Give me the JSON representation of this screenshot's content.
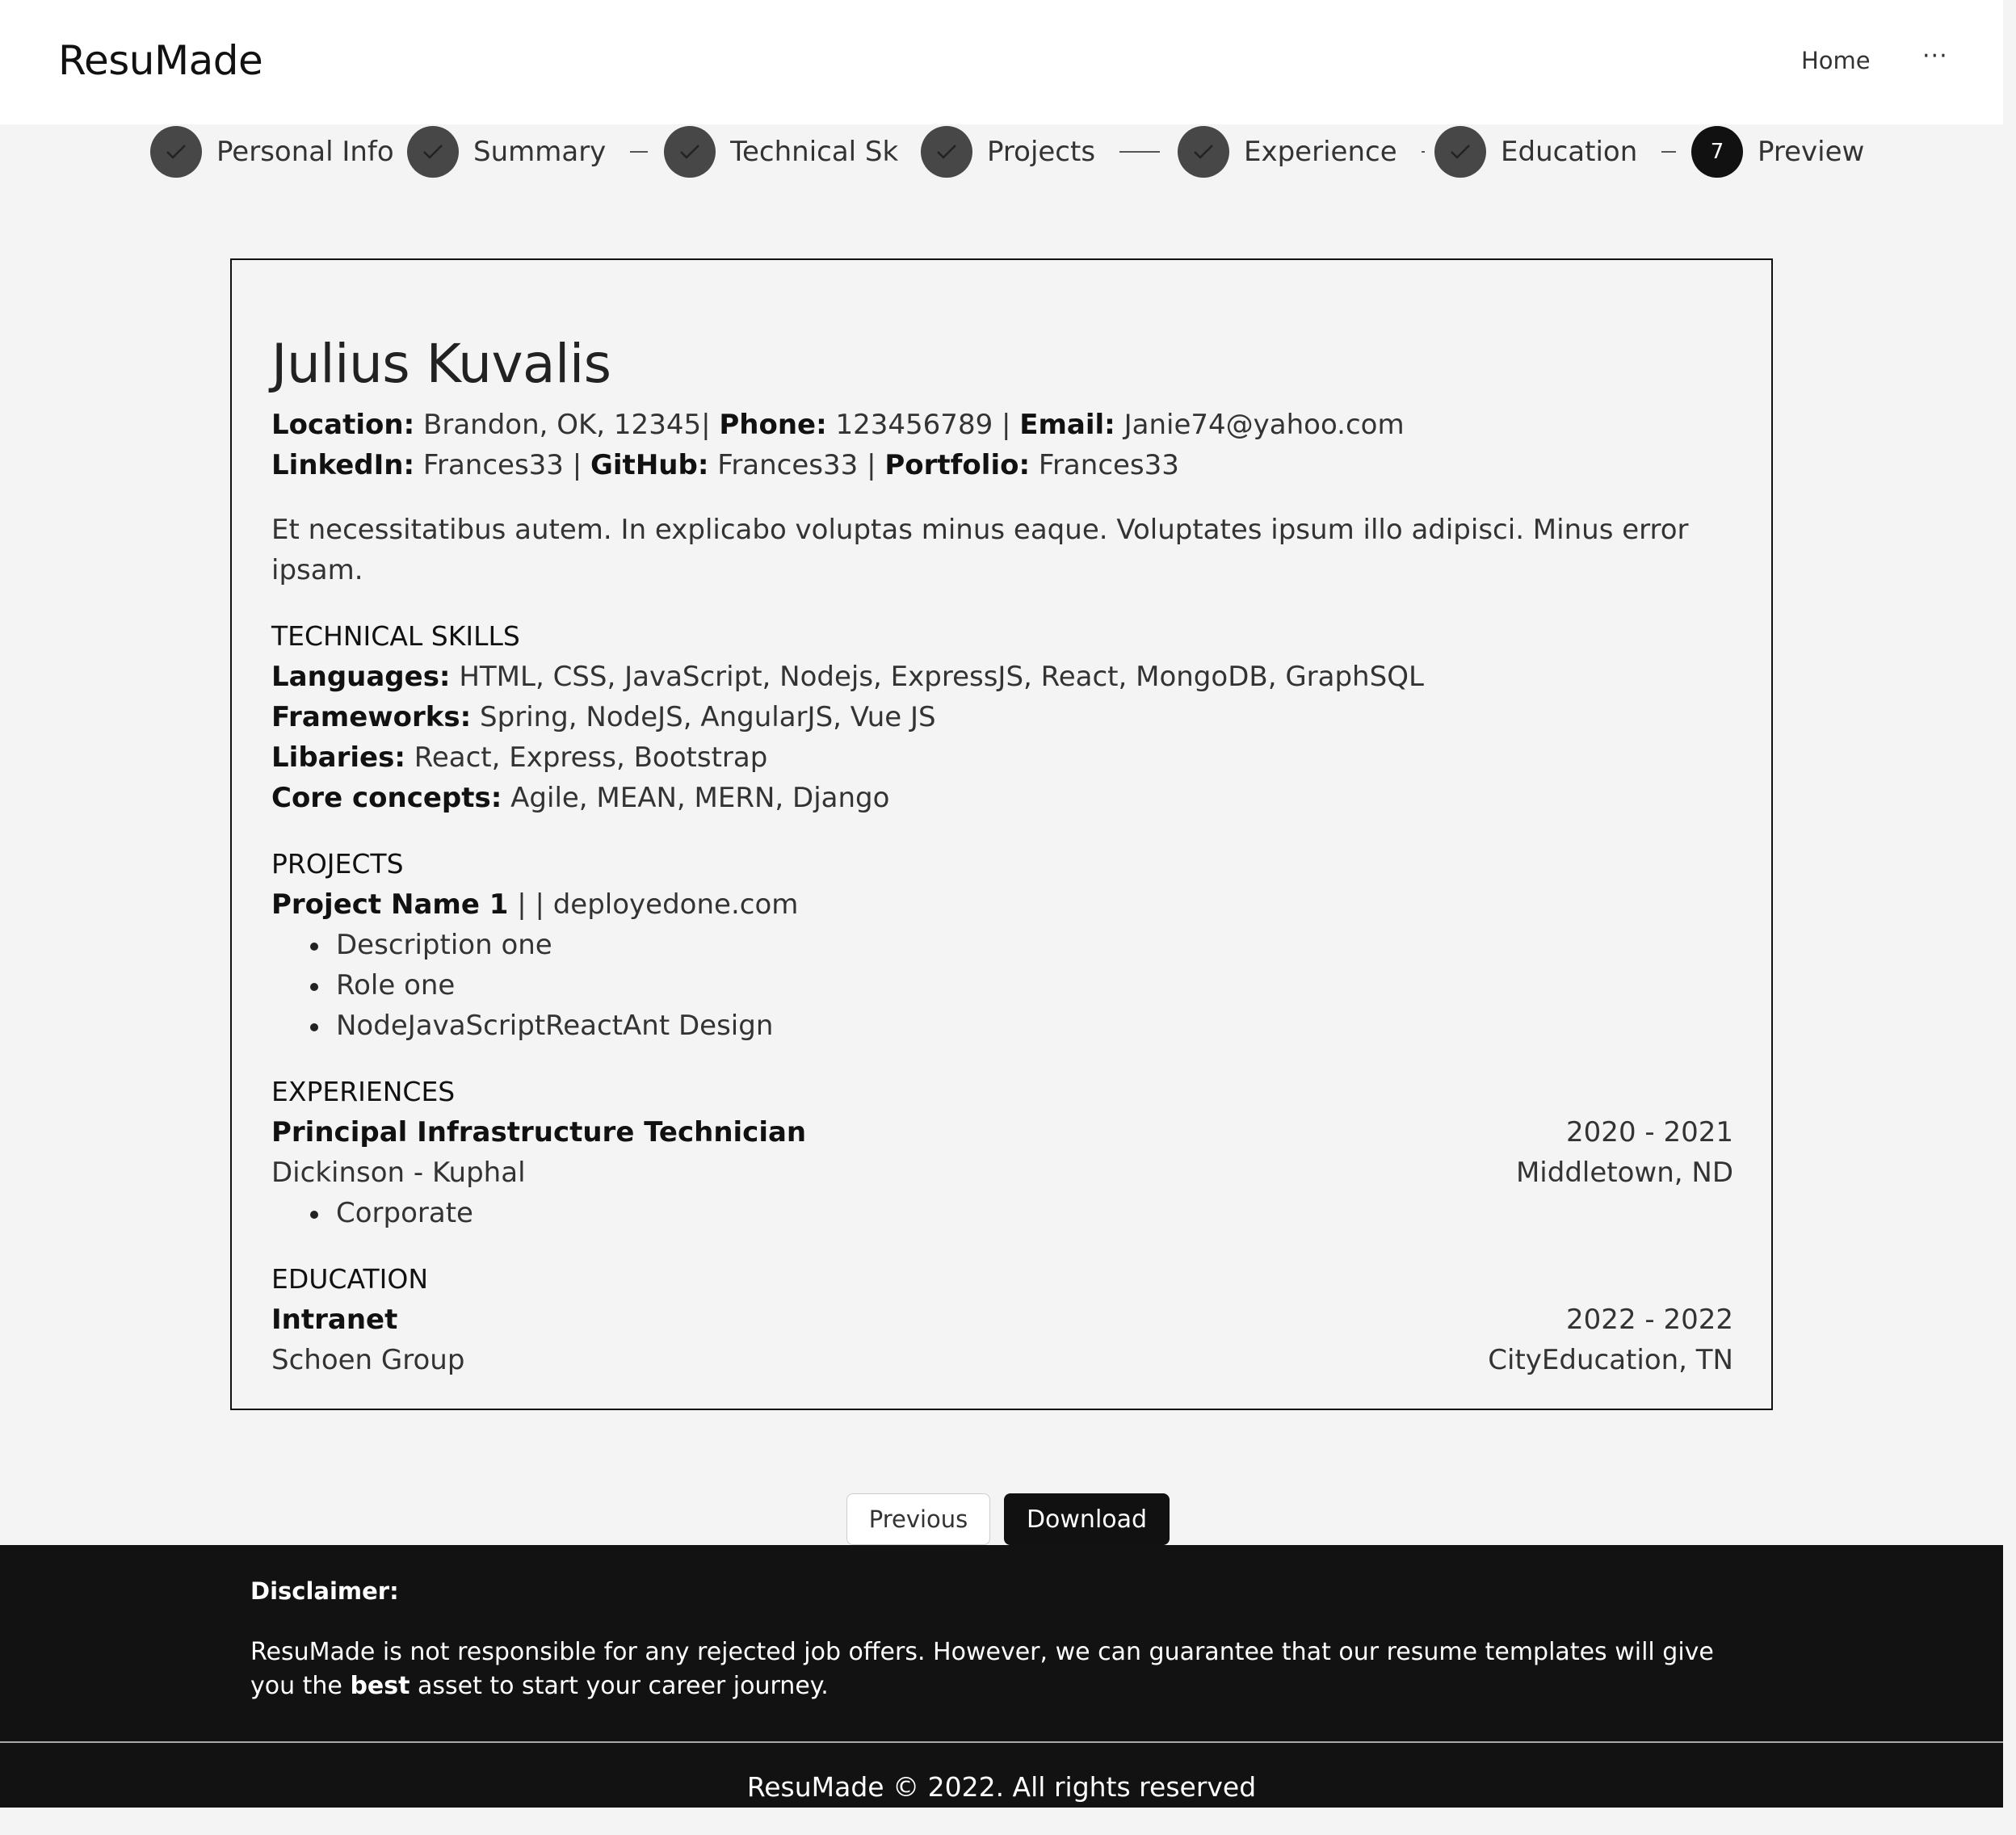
{
  "header": {
    "brand": "ResuMade",
    "home": "Home",
    "more": "···"
  },
  "steps": [
    {
      "label": "Personal Info",
      "state": "done"
    },
    {
      "label": "Summary",
      "state": "done"
    },
    {
      "label": "Technical Skills",
      "state": "done"
    },
    {
      "label": "Projects",
      "state": "done"
    },
    {
      "label": "Experience",
      "state": "done"
    },
    {
      "label": "Education",
      "state": "done"
    },
    {
      "label": "Preview",
      "state": "active",
      "number": "7"
    }
  ],
  "resume": {
    "name": "Julius Kuvalis",
    "contact": {
      "location_label": "Location:",
      "location": "Brandon, OK, 12345|",
      "phone_label": "Phone:",
      "phone": "123456789 |",
      "email_label": "Email:",
      "email": "Janie74@yahoo.com",
      "linkedin_label": "LinkedIn:",
      "linkedin": "Frances33 |",
      "github_label": "GitHub:",
      "github": "Frances33 |",
      "portfolio_label": "Portfolio:",
      "portfolio": "Frances33"
    },
    "summary": "Et necessitatibus autem. In explicabo voluptas minus eaque. Voluptates ipsum illo adipisci. Minus error ipsam.",
    "skills": {
      "title": "TECHNICAL SKILLS",
      "languages_label": "Languages:",
      "languages": "HTML, CSS, JavaScript, Nodejs, ExpressJS, React, MongoDB, GraphSQL",
      "frameworks_label": "Frameworks:",
      "frameworks": "Spring, NodeJS, AngularJS, Vue JS",
      "libraries_label": "Libaries:",
      "libraries": "React, Express, Bootstrap",
      "core_label": "Core concepts:",
      "core": "Agile, MEAN, MERN, Django"
    },
    "projects": {
      "title": "PROJECTS",
      "name": "Project Name 1",
      "link": "| | deployedone.com",
      "bullets": [
        "Description one",
        "Role one",
        "NodeJavaScriptReactAnt Design"
      ]
    },
    "experience": {
      "title": "EXPERIENCES",
      "role": "Principal Infrastructure Technician",
      "dates": "2020 - 2021",
      "company": "Dickinson - Kuphal",
      "location": "Middletown, ND",
      "bullets": [
        "Corporate"
      ]
    },
    "education": {
      "title": "EDUCATION",
      "degree": "Intranet",
      "dates": "2022 - 2022",
      "school": "Schoen Group",
      "location": "CityEducation, TN"
    }
  },
  "actions": {
    "previous": "Previous",
    "download": "Download"
  },
  "footer": {
    "disclaimer_title": "Disclaimer:",
    "disclaimer_pre": "ResuMade is not responsible for any rejected job offers. However, we can guarantee that our resume templates will give you the ",
    "disclaimer_bold": "best",
    "disclaimer_post": " asset to start your career journey.",
    "copyright": "ResuMade © 2022. All rights reserved"
  }
}
